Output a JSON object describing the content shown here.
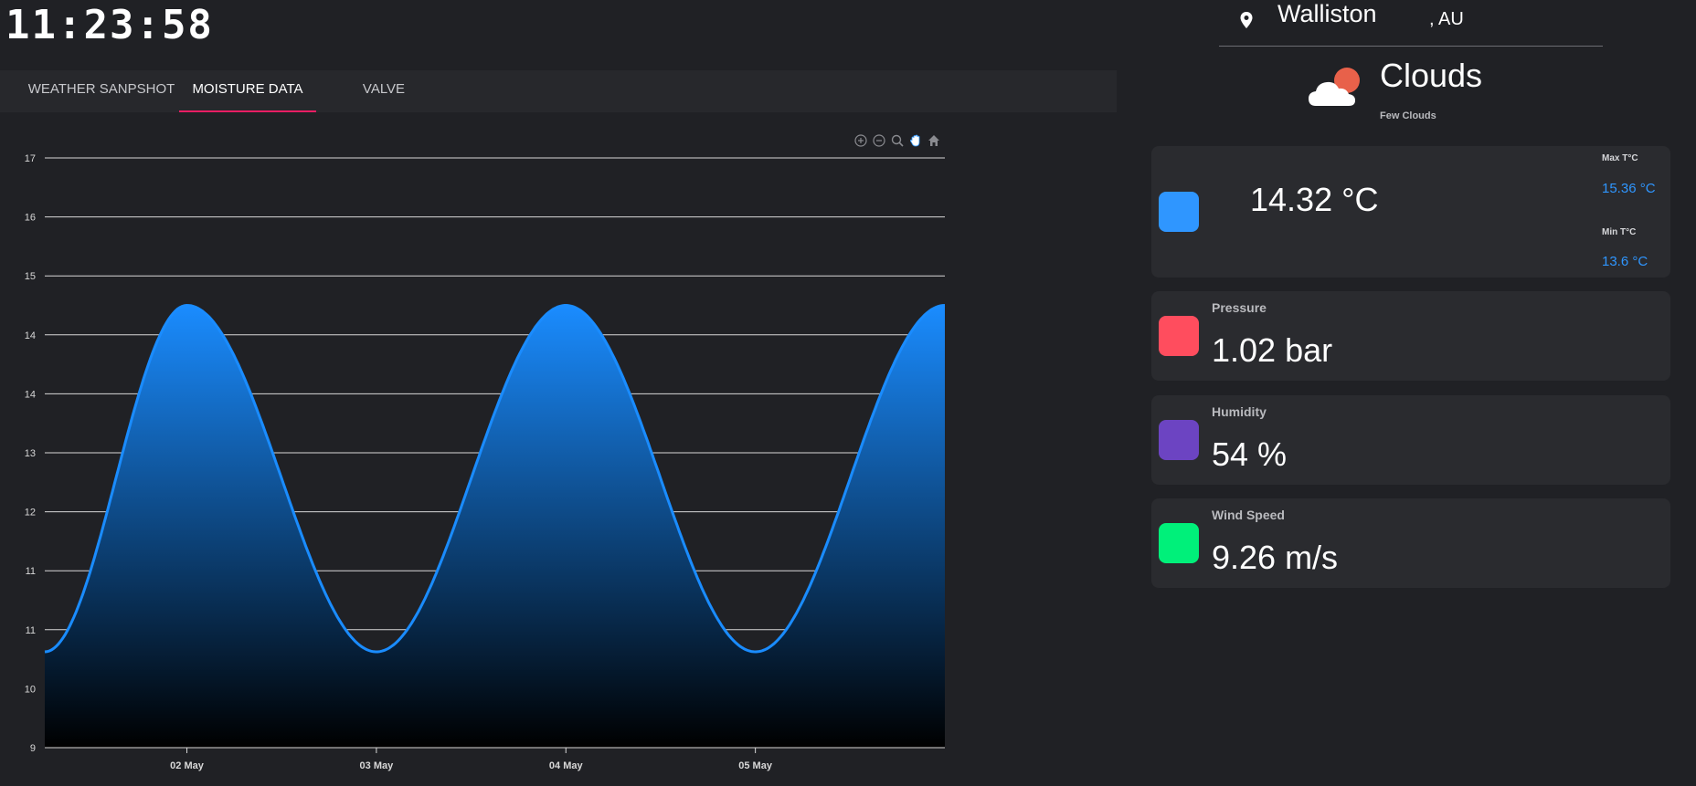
{
  "clock": "11:23:58",
  "tabs": [
    {
      "label": "WEATHER SANPSHOT",
      "active": false
    },
    {
      "label": "MOISTURE DATA",
      "active": true
    },
    {
      "label": "VALVE",
      "active": false
    }
  ],
  "location": {
    "city": "Walliston",
    "country": ", AU"
  },
  "condition": {
    "main": "Clouds",
    "description": "Few Clouds"
  },
  "temperature": {
    "value": "14.32 °C",
    "max_label": "Max T°C",
    "max_value": "15.36 °C",
    "min_label": "Min T°C",
    "min_value": "13.6 °C",
    "color": "#2f96ff"
  },
  "pressure": {
    "label": "Pressure",
    "value": "1.02 bar",
    "color": "#ff4d5e"
  },
  "humidity": {
    "label": "Humidity",
    "value": "54 %",
    "color": "#6c44c2"
  },
  "wind": {
    "label": "Wind Speed",
    "value": "9.26 m/s",
    "color": "#00f07a"
  },
  "chart_toolbar": [
    "zoom-in-icon",
    "zoom-out-icon",
    "magnifier-icon",
    "pan-hand-icon",
    "home-icon"
  ],
  "chart_data": {
    "type": "area",
    "title": "",
    "xlabel": "",
    "ylabel": "",
    "series_color": "#1a8cff",
    "x_ticks": [
      "02 May",
      "03 May",
      "04 May",
      "05 May"
    ],
    "y_ticks": [
      "17",
      "16",
      "15",
      "14",
      "14",
      "13",
      "12",
      "11",
      "11",
      "10",
      "9"
    ],
    "y_range": [
      9,
      17
    ],
    "x_range": [
      0.25,
      5
    ],
    "x": [
      0.25,
      1,
      2,
      3,
      4,
      5
    ],
    "y": [
      10.3,
      15,
      10.3,
      15,
      10.3,
      15
    ],
    "grid": true
  }
}
